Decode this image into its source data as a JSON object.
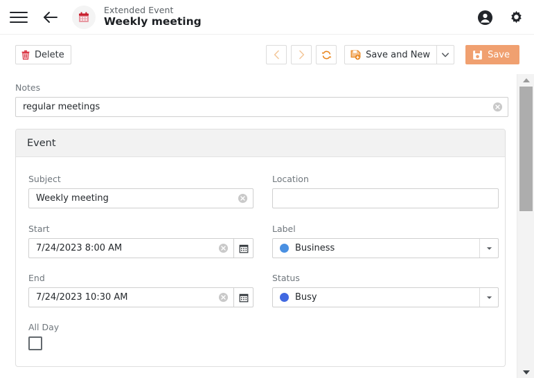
{
  "header": {
    "menu_icon": "hamburger-icon",
    "back_icon": "back-arrow-icon",
    "app_icon": "calendar-icon",
    "subtitle": "Extended Event",
    "title": "Weekly meeting",
    "account_icon": "account-circle-icon",
    "settings_icon": "gear-icon"
  },
  "toolbar": {
    "delete_label": "Delete",
    "delete_icon": "trash-icon",
    "prev_icon": "chevron-left-icon",
    "next_icon": "chevron-right-icon",
    "refresh_icon": "refresh-icon",
    "save_new_label": "Save and New",
    "save_new_icon": "save-add-icon",
    "save_new_caret_icon": "chevron-down-icon",
    "save_label": "Save",
    "save_icon": "floppy-disk-icon",
    "accent_color": "#e8841c",
    "save_button_color": "#f0a070",
    "delete_icon_color": "#d9313f"
  },
  "form": {
    "notes": {
      "label": "Notes",
      "value": "regular meetings",
      "placeholder": "",
      "clear_icon": "clear-circle-icon"
    },
    "panel_title": "Event",
    "subject": {
      "label": "Subject",
      "value": "Weekly meeting",
      "placeholder": "",
      "clear_icon": "clear-circle-icon"
    },
    "location": {
      "label": "Location",
      "value": "",
      "placeholder": ""
    },
    "start": {
      "label": "Start",
      "value": "7/24/2023 8:00 AM",
      "clear_icon": "clear-circle-icon",
      "picker_icon": "calendar-picker-icon"
    },
    "end": {
      "label": "End",
      "value": "7/24/2023 10:30 AM",
      "clear_icon": "clear-circle-icon",
      "picker_icon": "calendar-picker-icon"
    },
    "label_field": {
      "label": "Label",
      "value": "Business",
      "dot_color": "#4a90e2",
      "caret_icon": "chevron-down-icon"
    },
    "status_field": {
      "label": "Status",
      "value": "Busy",
      "dot_color": "#4169e1",
      "caret_icon": "chevron-down-icon"
    },
    "all_day": {
      "label": "All Day",
      "checked": false
    }
  },
  "scrollbar": {
    "up_icon": "scroll-up-arrow-icon",
    "down_icon": "scroll-down-arrow-icon",
    "thumb_name": "scrollbar-thumb"
  }
}
